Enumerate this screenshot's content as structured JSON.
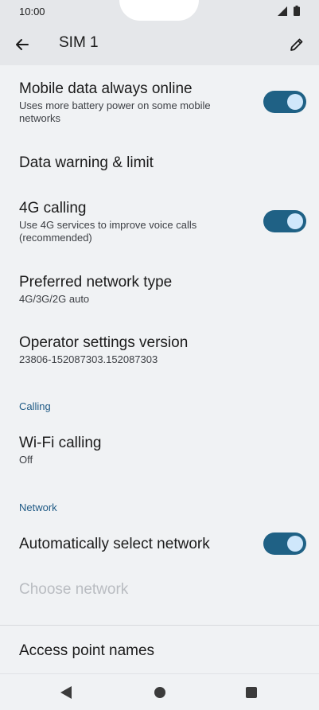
{
  "status_bar": {
    "time": "10:00"
  },
  "app_bar": {
    "title": "SIM 1"
  },
  "items": {
    "mobile_data": {
      "title": "Mobile data always online",
      "summary": "Uses more battery power on some mobile networks",
      "toggle_on": true
    },
    "data_warning": {
      "title": "Data warning & limit"
    },
    "calling_4g": {
      "title": "4G calling",
      "summary": "Use 4G services to improve voice calls (recommended)",
      "toggle_on": true
    },
    "preferred_network": {
      "title": "Preferred network type",
      "summary": "4G/3G/2G auto"
    },
    "operator_settings": {
      "title": "Operator settings version",
      "summary": "23806-152087303.152087303"
    },
    "wifi_calling": {
      "title": "Wi-Fi calling",
      "summary": "Off"
    },
    "auto_select_network": {
      "title": "Automatically select network",
      "toggle_on": true
    },
    "choose_network": {
      "title": "Choose network"
    },
    "access_point_names": {
      "title": "Access point names"
    }
  },
  "sections": {
    "calling": "Calling",
    "network": "Network"
  },
  "colors": {
    "accent": "#1f6185",
    "toggle_thumb": "#cfe7fb",
    "section_header": "#1f5a85",
    "background": "#f0f2f4"
  },
  "icons": {
    "back": "arrow-left-icon",
    "edit": "pencil-icon",
    "signal": "signal-icon",
    "battery": "battery-icon",
    "nav_back": "triangle-back-icon",
    "nav_home": "circle-home-icon",
    "nav_recents": "square-recents-icon"
  }
}
